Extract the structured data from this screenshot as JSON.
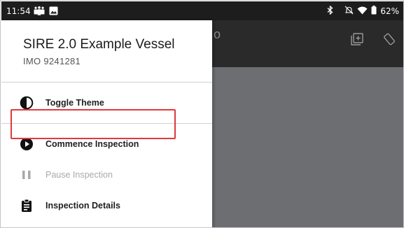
{
  "status_bar": {
    "time": "11:54",
    "battery": "62%",
    "icons": [
      "teams-icon",
      "image-icon",
      "bluetooth-icon",
      "mute-icon",
      "wifi-icon",
      "battery-icon"
    ]
  },
  "app_bar": {
    "title_fragment": "o",
    "icons": [
      "add-box-icon",
      "rotate-icon"
    ]
  },
  "drawer": {
    "vessel_name": "SIRE 2.0 Example Vessel",
    "imo": "IMO 9241281",
    "items": [
      {
        "label": "Toggle Theme",
        "icon": "contrast-icon",
        "enabled": true
      },
      {
        "label": "Commence Inspection",
        "icon": "play-circle-icon",
        "enabled": true,
        "highlighted": true
      },
      {
        "label": "Pause Inspection",
        "icon": "pause-icon",
        "enabled": false
      },
      {
        "label": "Inspection Details",
        "icon": "clipboard-icon",
        "enabled": true
      }
    ]
  },
  "colors": {
    "status_bar_bg": "#1d1d1d",
    "app_bar_bg": "#2a2a2a",
    "scrim": "#6d6e72",
    "highlight": "#e03a3a",
    "disabled_text": "#a9a9a9"
  }
}
